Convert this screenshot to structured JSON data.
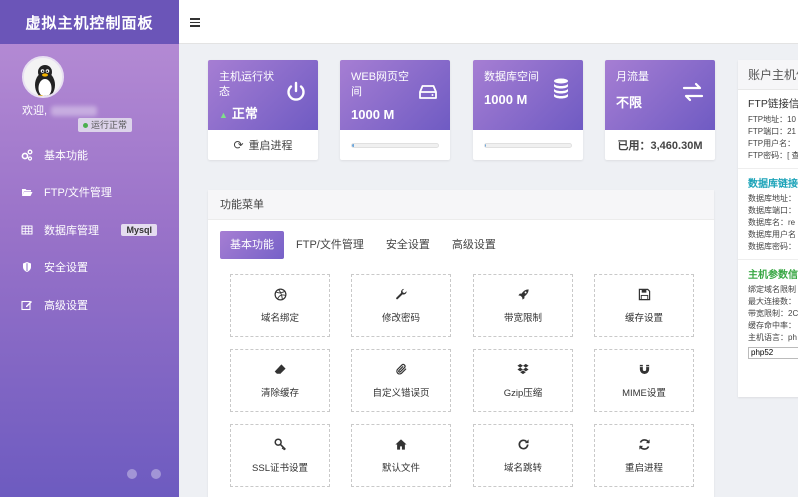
{
  "sidebar": {
    "title": "虚拟主机控制面板",
    "welcome": "欢迎,",
    "status": "运行正常",
    "items": [
      {
        "label": "基本功能",
        "icon": "gears-icon"
      },
      {
        "label": "FTP/文件管理",
        "icon": "folder-open-icon"
      },
      {
        "label": "数据库管理",
        "icon": "table-icon",
        "badge": "Mysql"
      },
      {
        "label": "安全设置",
        "icon": "shield-icon"
      },
      {
        "label": "高级设置",
        "icon": "edit-icon"
      }
    ]
  },
  "cards": {
    "host": {
      "title": "主机运行状态",
      "value": "正常",
      "action": "重启进程"
    },
    "web": {
      "title": "WEB网页空间",
      "value": "1000 M",
      "progress": 0.02
    },
    "db": {
      "title": "数据库空间",
      "value": "1000 M",
      "progress": 0.01
    },
    "traffic": {
      "title": "月流量",
      "value": "不限",
      "used": "已用：3,460.30M"
    }
  },
  "menu": {
    "title": "功能菜单",
    "tabs": [
      "基本功能",
      "FTP/文件管理",
      "安全设置",
      "高级设置"
    ],
    "active_tab": 0,
    "tiles": [
      {
        "label": "域名绑定",
        "icon": "dribbble-icon"
      },
      {
        "label": "修改密码",
        "icon": "wrench-icon"
      },
      {
        "label": "带宽限制",
        "icon": "rocket-icon"
      },
      {
        "label": "缓存设置",
        "icon": "save-icon"
      },
      {
        "label": "清除缓存",
        "icon": "eraser-icon"
      },
      {
        "label": "自定义错误页",
        "icon": "paperclip-icon"
      },
      {
        "label": "Gzip压缩",
        "icon": "dropbox-icon"
      },
      {
        "label": "MIME设置",
        "icon": "magnet-icon"
      },
      {
        "label": "SSL证书设置",
        "icon": "key-icon"
      },
      {
        "label": "默认文件",
        "icon": "home-icon"
      },
      {
        "label": "域名跳转",
        "icon": "redo-icon"
      },
      {
        "label": "重启进程",
        "icon": "refresh-icon"
      }
    ]
  },
  "info": {
    "title": "账户主机信",
    "ftp": {
      "title": "FTP链接信息",
      "lines": [
        "FTP地址：10",
        "FTP端口：21",
        "FTP用户名：",
        "FTP密码：[ 查"
      ]
    },
    "db": {
      "title": "数据库链接",
      "lines": [
        "数据库地址：",
        "数据库端口：",
        "数据库名：re",
        "数据库用户名",
        "数据库密码："
      ]
    },
    "host": {
      "title": "主机参数信",
      "lines": [
        "绑定域名限制",
        "最大连接数：",
        "带宽限制：2C",
        "缓存命中率：",
        "主机语言：ph"
      ],
      "select_value": "php52"
    }
  },
  "colors": {
    "accent": "#7661c8",
    "db_section": "#1ba3b8",
    "host_section": "#3aa845"
  }
}
